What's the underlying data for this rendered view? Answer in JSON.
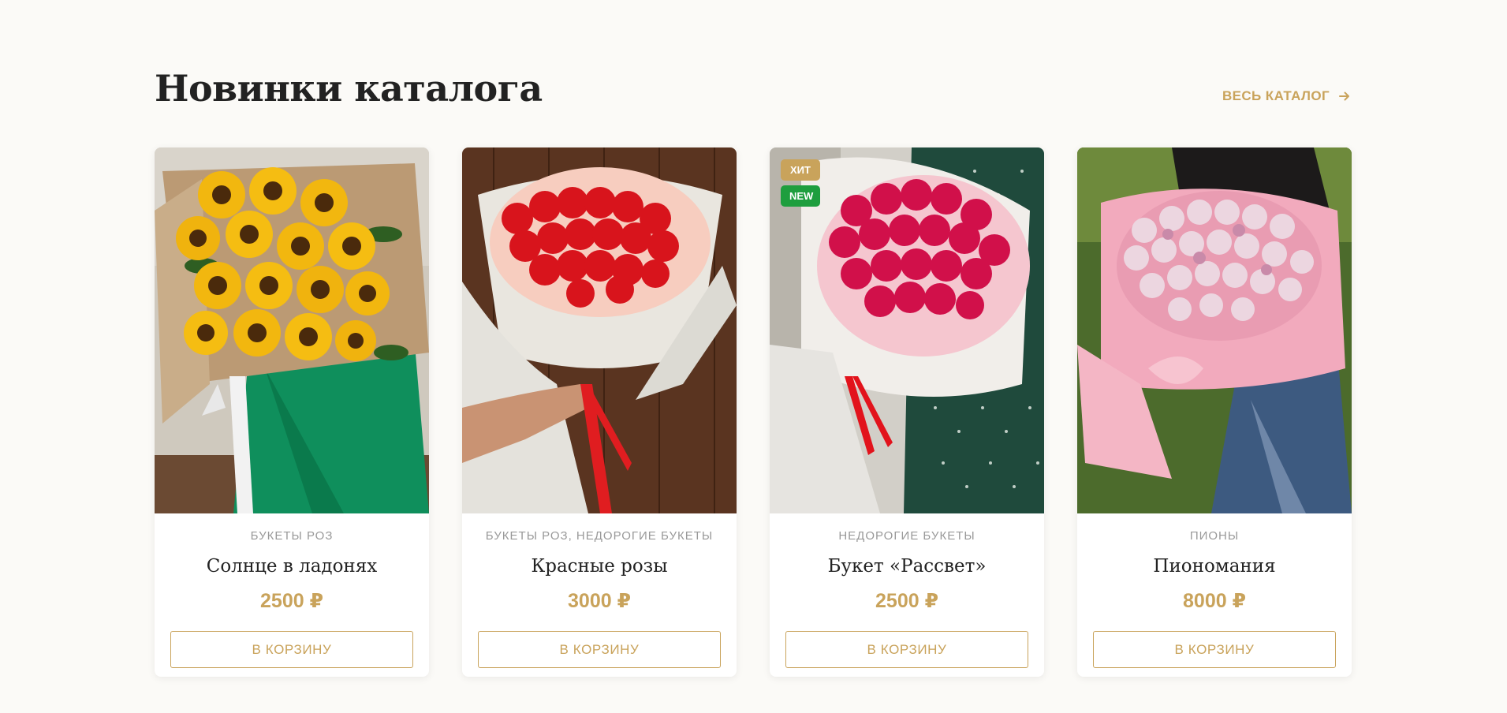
{
  "section": {
    "title": "Новинки каталога",
    "catalog_link": "ВЕСЬ КАТАЛОГ",
    "catalog_link_icon": "arrow-right-icon"
  },
  "colors": {
    "accent": "#c9a35b",
    "badge_hit": "#c9a35b",
    "badge_new": "#1e9e3e"
  },
  "products": [
    {
      "category": "БУКЕТЫ РОЗ",
      "title": "Солнце в ладонях",
      "price": "2500 ₽",
      "button": "В КОРЗИНУ",
      "badges": []
    },
    {
      "category": "БУКЕТЫ РОЗ, НЕДОРОГИЕ БУКЕТЫ",
      "title": "Красные розы",
      "price": "3000 ₽",
      "button": "В КОРЗИНУ",
      "badges": []
    },
    {
      "category": "НЕДОРОГИЕ БУКЕТЫ",
      "title": "Букет «Рассвет»",
      "price": "2500 ₽",
      "button": "В КОРЗИНУ",
      "badges": [
        "ХИТ",
        "NEW"
      ]
    },
    {
      "category": "ПИОНЫ",
      "title": "Пиономания",
      "price": "8000 ₽",
      "button": "В КОРЗИНУ",
      "badges": []
    }
  ]
}
